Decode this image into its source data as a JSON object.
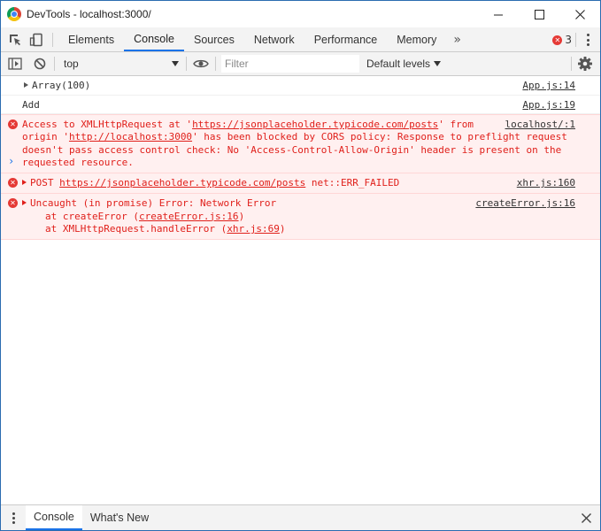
{
  "window": {
    "title": "DevTools - localhost:3000/",
    "minimize": "—",
    "maximize": "☐",
    "close": "✕"
  },
  "tabs": {
    "items": [
      "Elements",
      "Console",
      "Sources",
      "Network",
      "Performance",
      "Memory"
    ],
    "active": "Console",
    "more": "»",
    "error_count": "3"
  },
  "console_toolbar": {
    "context": "top",
    "filter_placeholder": "Filter",
    "levels": "Default levels"
  },
  "messages": [
    {
      "type": "log",
      "text": "Array(100)",
      "expandable": true,
      "source": "App.js:14"
    },
    {
      "type": "log",
      "text": "Add",
      "expandable": false,
      "source": "App.js:19"
    },
    {
      "type": "error",
      "source": "localhost/:1",
      "part1": "Access to XMLHttpRequest at '",
      "url1": "https://jsonplaceholder.typicode.com/posts",
      "part2": "' from\norigin '",
      "url2": "http://localhost:3000",
      "part3": "' has been blocked by CORS policy: Response to preflight request doesn't pass access control check: No 'Access-Control-Allow-Origin' header is present on the requested resource."
    },
    {
      "type": "error",
      "source": "xhr.js:160",
      "prefix": "POST ",
      "url": "https://jsonplaceholder.typicode.com/posts",
      "suffix": " net::ERR_FAILED"
    },
    {
      "type": "error",
      "source": "createError.js:16",
      "text": "Uncaught (in promise) Error: Network Error",
      "stack": [
        {
          "prefix": "at createError (",
          "link": "createError.js:16",
          "suffix": ")"
        },
        {
          "prefix": "at XMLHttpRequest.handleError (",
          "link": "xhr.js:69",
          "suffix": ")"
        }
      ]
    }
  ],
  "prompt": "›",
  "drawer": {
    "tabs": [
      "Console",
      "What's New"
    ],
    "close": "✕"
  },
  "colors": {
    "accent": "#1a73e8",
    "error_text": "#e0201b",
    "error_bg": "#fff0f0",
    "error_badge": "#e53935"
  }
}
